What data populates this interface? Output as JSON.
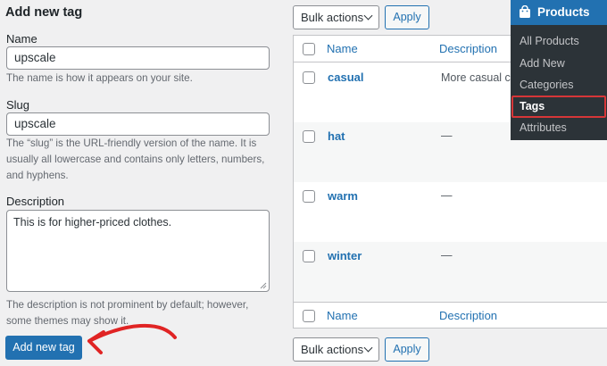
{
  "form": {
    "title": "Add new tag",
    "name_label": "Name",
    "name_value": "upscale",
    "name_help": "The name is how it appears on your site.",
    "slug_label": "Slug",
    "slug_value": "upscale",
    "slug_help": "The “slug” is the URL-friendly version of the name. It is usually all lowercase and contains only letters, numbers, and hyphens.",
    "description_label": "Description",
    "description_value": "This is for higher-priced clothes.",
    "description_help": "The description is not prominent by default; however, some themes may show it.",
    "submit_label": "Add new tag"
  },
  "bulk": {
    "top_label": "Bulk actions",
    "bottom_label": "Bulk actions",
    "apply_label": "Apply"
  },
  "table": {
    "headers": {
      "name": "Name",
      "description": "Description"
    },
    "rows": [
      {
        "name": "casual",
        "description": "More casual clo"
      },
      {
        "name": "hat",
        "description": "—"
      },
      {
        "name": "warm",
        "description": "—"
      },
      {
        "name": "winter",
        "description": "—"
      }
    ]
  },
  "menu": {
    "title": "Products",
    "items": [
      {
        "label": "All Products"
      },
      {
        "label": "Add New"
      },
      {
        "label": "Categories"
      },
      {
        "label": "Tags",
        "active": true
      },
      {
        "label": "Attributes"
      }
    ],
    "highlight_color": "#d63638"
  },
  "colors": {
    "accent": "#2271b1",
    "annotation": "#e02424",
    "menu_bg": "#2c3338"
  }
}
